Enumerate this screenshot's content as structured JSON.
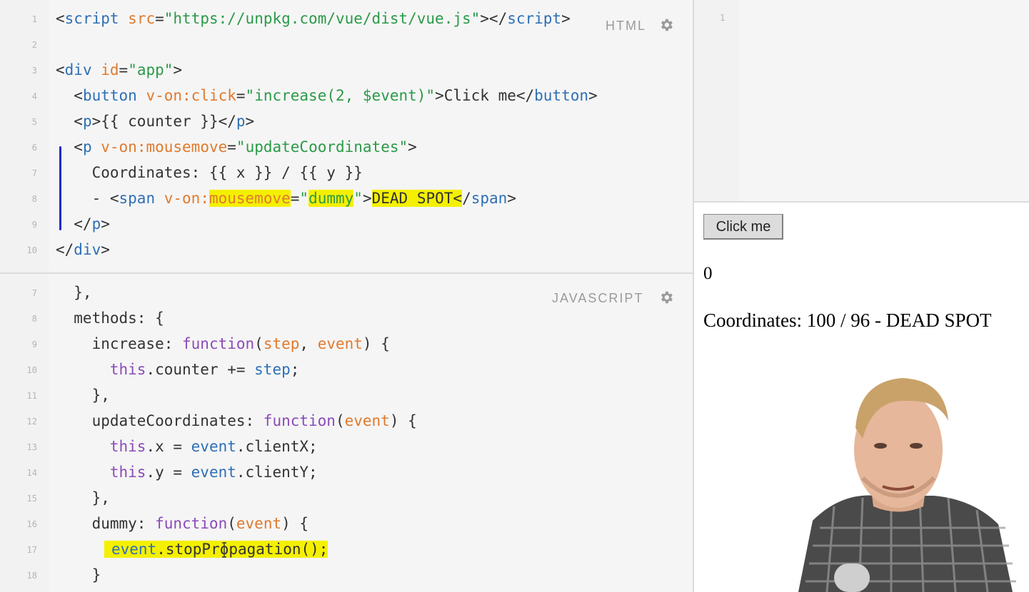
{
  "html_editor": {
    "label": "HTML",
    "lines": [
      {
        "n": "1"
      },
      {
        "n": "2"
      },
      {
        "n": "3"
      },
      {
        "n": "4"
      },
      {
        "n": "5"
      },
      {
        "n": "6"
      },
      {
        "n": "7"
      },
      {
        "n": "8"
      },
      {
        "n": "9"
      },
      {
        "n": "10"
      }
    ],
    "code": {
      "l1": [
        "<",
        "script",
        " ",
        "src",
        "=",
        "\"https://unpkg.com/vue/dist/vue.js\"",
        "></",
        "script",
        ">"
      ],
      "l3": [
        "<",
        "div",
        " ",
        "id",
        "=",
        "\"app\"",
        ">"
      ],
      "l4": [
        "  <",
        "button",
        " ",
        "v-on:click",
        "=",
        "\"increase(2, $event)\"",
        ">Click me</",
        "button",
        ">"
      ],
      "l5": [
        "  <",
        "p",
        ">{{ counter }}</",
        "p",
        ">"
      ],
      "l6": [
        "  <",
        "p",
        " ",
        "v-on:mousemove",
        "=",
        "\"updateCoordinates\"",
        ">"
      ],
      "l7": "    Coordinates: {{ x }} / {{ y }}",
      "l8": [
        "    - <",
        "span",
        " ",
        "v-on:",
        "mousemove",
        "=",
        "\"",
        "dummy",
        "\"",
        ">",
        "DEAD SPOT",
        "<",
        "/",
        "span",
        ">"
      ],
      "l9": [
        "  </",
        "p",
        ">"
      ],
      "l10": [
        "</",
        "div",
        ">"
      ]
    }
  },
  "js_editor": {
    "label": "JAVASCRIPT",
    "lines": [
      {
        "n": "7"
      },
      {
        "n": "8"
      },
      {
        "n": "9"
      },
      {
        "n": "10"
      },
      {
        "n": "11"
      },
      {
        "n": "12"
      },
      {
        "n": "13"
      },
      {
        "n": "14"
      },
      {
        "n": "15"
      },
      {
        "n": "16"
      },
      {
        "n": "17"
      },
      {
        "n": "18"
      }
    ],
    "code": {
      "l7": "  },",
      "l8": "  methods: {",
      "l9": [
        "    increase: ",
        "function",
        "(",
        "step",
        ", ",
        "event",
        ") {"
      ],
      "l10": [
        "      ",
        "this",
        ".counter += ",
        "step",
        ";"
      ],
      "l11": "    },",
      "l12": [
        "    updateCoordinates: ",
        "function",
        "(",
        "event",
        ") {"
      ],
      "l13": [
        "      ",
        "this",
        ".x = ",
        "event",
        ".clientX;"
      ],
      "l14": [
        "      ",
        "this",
        ".y = ",
        "event",
        ".clientY;"
      ],
      "l15": "    },",
      "l16": [
        "    dummy: ",
        "function",
        "(",
        "event",
        ") {"
      ],
      "l17": [
        "event",
        ".stopPropagation();"
      ],
      "l18": "    }"
    }
  },
  "css_editor": {
    "line": "1"
  },
  "result": {
    "button_label": "Click me",
    "counter": "0",
    "coordinates": "Coordinates: 100 / 96 - DEAD SPOT"
  },
  "colors": {
    "tag": "#2e6fb5",
    "attribute": "#e07a2e",
    "string": "#2b9a48",
    "keyword": "#8a4bb8",
    "highlight": "#f4f000",
    "pen": "#1a2acc"
  },
  "icons": {
    "settings": "gear-icon"
  }
}
